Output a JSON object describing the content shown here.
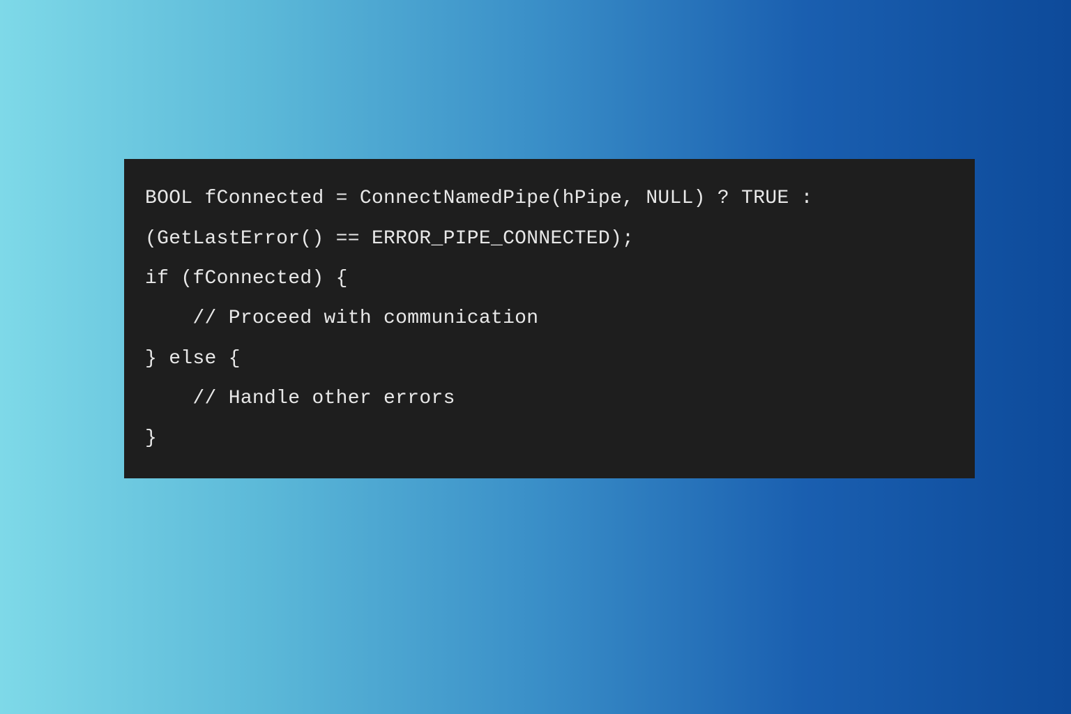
{
  "code": {
    "line1": "BOOL fConnected = ConnectNamedPipe(hPipe, NULL) ? TRUE :",
    "line2": "(GetLastError() == ERROR_PIPE_CONNECTED);",
    "line3": "if (fConnected) {",
    "line4": "    // Proceed with communication",
    "line5": "} else {",
    "line6": "    // Handle other errors",
    "line7": "}"
  }
}
